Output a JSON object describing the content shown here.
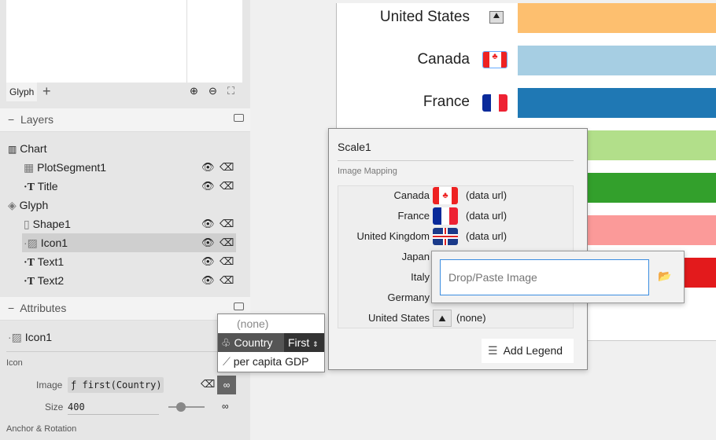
{
  "left": {
    "tab": "Glyph",
    "layers_title": "Layers",
    "attributes_title": "Attributes",
    "layers": [
      {
        "label": "Chart",
        "icon": "chart-icon"
      },
      {
        "label": "PlotSegment1",
        "icon": "grid-icon"
      },
      {
        "label": "Title",
        "icon": "text-icon"
      },
      {
        "label": "Glyph",
        "icon": "glyph-icon"
      },
      {
        "label": "Shape1",
        "icon": "rect-icon"
      },
      {
        "label": "Icon1",
        "icon": "image-icon",
        "selected": true
      },
      {
        "label": "Text1",
        "icon": "text-icon"
      },
      {
        "label": "Text2",
        "icon": "text-icon"
      }
    ],
    "attr": {
      "object": "Icon1",
      "group": "Icon",
      "image_label": "Image",
      "image_value": "first(Country)",
      "fx": "ƒ",
      "size_label": "Size",
      "size_value": "400",
      "size_fraction": 0.4,
      "anchor": "Anchor & Rotation"
    }
  },
  "dropdown": {
    "none": "(none)",
    "country": "Country",
    "agg": "First",
    "gdp": "per capita GDP"
  },
  "chart": {
    "labels": [
      "United States",
      "Canada",
      "France"
    ],
    "bar_colors": [
      "#fdbf6f",
      "#a6cee3",
      "#1f78b4",
      "#b2df8a",
      "#33a02c",
      "#fb9a99",
      "#e31a1c"
    ]
  },
  "scale": {
    "title": "Scale1",
    "section": "Image Mapping",
    "rows": [
      {
        "key": "Canada",
        "value": "(data url)",
        "flag": "canada"
      },
      {
        "key": "France",
        "value": "(data url)",
        "flag": "france"
      },
      {
        "key": "United Kingdom",
        "value": "(data url)",
        "flag": "uk"
      },
      {
        "key": "Japan",
        "value": ""
      },
      {
        "key": "Italy",
        "value": ""
      },
      {
        "key": "Germany",
        "value": ""
      },
      {
        "key": "United States",
        "value": "(none)",
        "flag": "none"
      }
    ],
    "add_legend": "Add Legend"
  },
  "image_input": {
    "placeholder": "Drop/Paste Image"
  }
}
